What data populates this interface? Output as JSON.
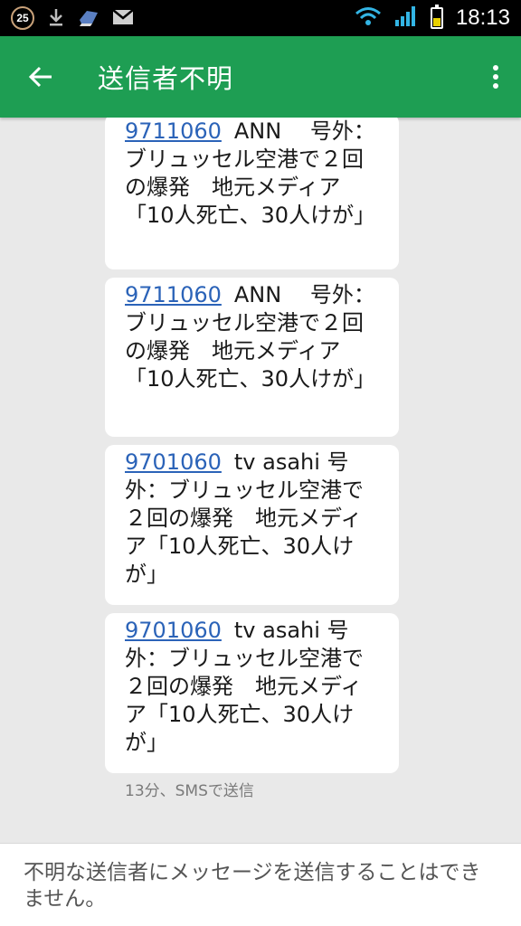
{
  "status_bar": {
    "notification_count": "25",
    "time": "18:13",
    "icons": [
      "download-icon",
      "app-icon",
      "gmail-icon",
      "wifi-icon",
      "signal-icon",
      "battery-icon"
    ]
  },
  "app_bar": {
    "title": "送信者不明"
  },
  "messages": [
    {
      "number": "9711060",
      "text": "ANN　 号外：ブリュッセル空港で２回の爆発　地元メディア「10人死亡、30人けが」"
    },
    {
      "number": "9711060",
      "text": "ANN　 号外：ブリュッセル空港で２回の爆発　地元メディア「10人死亡、30人けが」"
    },
    {
      "number": "9701060",
      "text": "tv asahi 号外：ブリュッセル空港で２回の爆発　地元メディア「10人死亡、30人けが」"
    },
    {
      "number": "9701060",
      "text": "tv asahi 号外：ブリュッセル空港で２回の爆発　地元メディア「10人死亡、30人けが」"
    }
  ],
  "meta": "13分、SMSで送信",
  "bottom_notice": "不明な送信者にメッセージを送信することはできません。",
  "colors": {
    "app_bar": "#1e9e53",
    "background": "#e9e9e9",
    "link": "#2b63b8"
  }
}
